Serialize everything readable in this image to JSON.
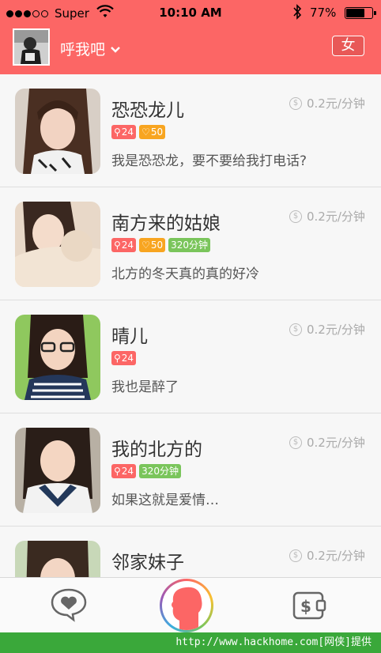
{
  "status_bar": {
    "carrier": "Super",
    "time": "10:10 AM",
    "battery_pct": "77%",
    "battery_level": 0.77
  },
  "header": {
    "title": "呼我吧",
    "gender_button": "女",
    "accent": "#fc6665"
  },
  "users": [
    {
      "name": "恐恐龙儿",
      "price": "0.2元/分钟",
      "fans": "24",
      "likes": "50",
      "minutes": "",
      "desc": "我是恐恐龙，要不要给我打电话?"
    },
    {
      "name": "南方来的姑娘",
      "price": "0.2元/分钟",
      "fans": "24",
      "likes": "50",
      "minutes": "320分钟",
      "desc": "北方的冬天真的真的好冷"
    },
    {
      "name": "晴儿",
      "price": "0.2元/分钟",
      "fans": "24",
      "likes": "",
      "minutes": "",
      "desc": "我也是醉了"
    },
    {
      "name": "我的北方的",
      "price": "0.2元/分钟",
      "fans": "24",
      "likes": "",
      "minutes": "320分钟",
      "desc": "如果这就是爱情…"
    },
    {
      "name": "邻家妹子",
      "price": "0.2元/分钟",
      "fans": "",
      "likes": "",
      "minutes": "",
      "desc": ""
    }
  ],
  "tabbar": {
    "icons": [
      "heart-chat-icon",
      "profile-silhouette-icon",
      "wallet-icon"
    ]
  },
  "footer": {
    "watermark": "http://www.hackhome.com[网侠]提供"
  }
}
